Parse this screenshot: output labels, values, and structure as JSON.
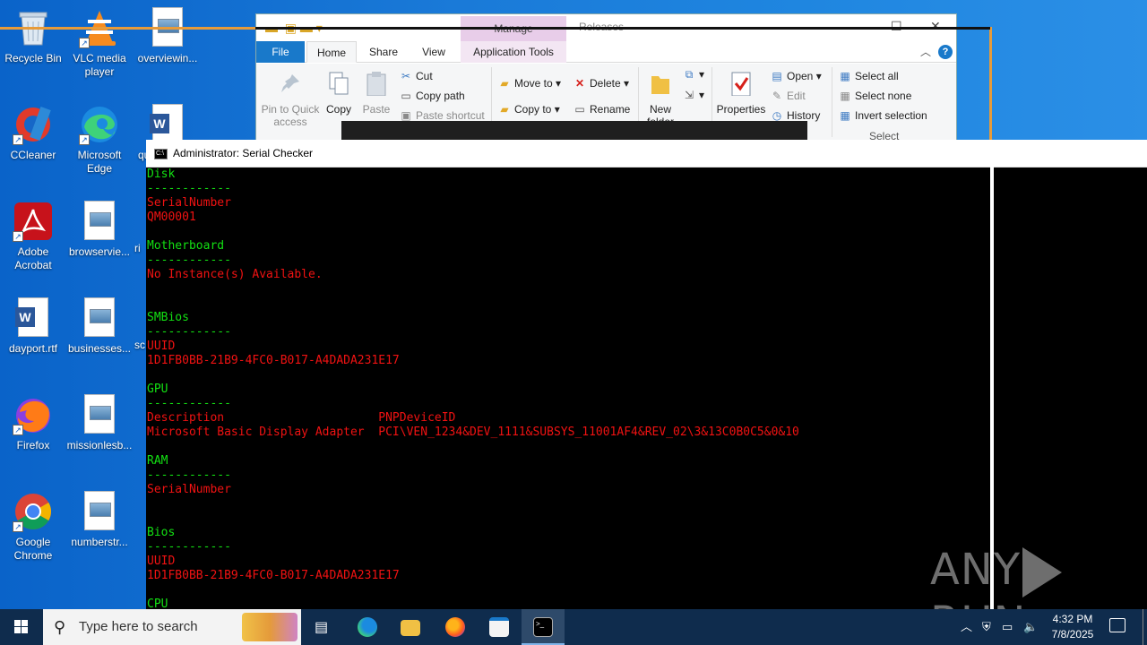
{
  "desktop": {
    "icons": [
      {
        "label": "Recycle Bin",
        "icon": "recycle-bin-icon"
      },
      {
        "label": "VLC media player",
        "icon": "vlc-icon"
      },
      {
        "label": "overviewin...",
        "icon": "image-file-icon"
      },
      {
        "label": "CCleaner",
        "icon": "ccleaner-icon"
      },
      {
        "label": "Microsoft Edge",
        "icon": "edge-icon"
      },
      {
        "label": "qu",
        "icon": "word-file-icon"
      },
      {
        "label": "Adobe Acrobat",
        "icon": "acrobat-icon"
      },
      {
        "label": "browservie...",
        "icon": "image-file-icon"
      },
      {
        "label": "ri",
        "icon": "image-file-icon"
      },
      {
        "label": "dayport.rtf",
        "icon": "word-file-icon"
      },
      {
        "label": "businesses...",
        "icon": "image-file-icon"
      },
      {
        "label": "sc",
        "icon": "image-file-icon"
      },
      {
        "label": "Firefox",
        "icon": "firefox-icon"
      },
      {
        "label": "missionlesb...",
        "icon": "image-file-icon"
      },
      {
        "label": "Google Chrome",
        "icon": "chrome-icon"
      },
      {
        "label": "numberstr...",
        "icon": "image-file-icon"
      }
    ]
  },
  "explorer": {
    "manage_tab": "Manage",
    "title": "Releases",
    "tabs": {
      "file": "File",
      "home": "Home",
      "share": "Share",
      "view": "View",
      "app_tools": "Application Tools"
    },
    "ribbon": {
      "pin": "Pin to Quick access",
      "copy": "Copy",
      "paste": "Paste",
      "cut": "Cut",
      "copy_path": "Copy path",
      "paste_shortcut": "Paste shortcut",
      "move_to": "Move to",
      "copy_to": "Copy to",
      "delete": "Delete",
      "rename": "Rename",
      "new_folder": "New folder",
      "properties": "Properties",
      "open": "Open",
      "edit": "Edit",
      "history": "History",
      "select_all": "Select all",
      "select_none": "Select none",
      "invert_selection": "Invert selection",
      "select_group": "Select"
    }
  },
  "console": {
    "title": "Administrator:  Serial Checker",
    "lines": [
      {
        "text": "Disk",
        "color": "green"
      },
      {
        "text": "------------",
        "color": "green"
      },
      {
        "text": "SerialNumber",
        "color": "red"
      },
      {
        "text": "QM00001",
        "color": "red"
      },
      {
        "text": "",
        "color": "red"
      },
      {
        "text": "Motherboard",
        "color": "green"
      },
      {
        "text": "------------",
        "color": "green"
      },
      {
        "text": "No Instance(s) Available.",
        "color": "red"
      },
      {
        "text": "",
        "color": "red"
      },
      {
        "text": "",
        "color": "red"
      },
      {
        "text": "SMBios",
        "color": "green"
      },
      {
        "text": "------------",
        "color": "green"
      },
      {
        "text": "UUID",
        "color": "red"
      },
      {
        "text": "1D1FB0BB-21B9-4FC0-B017-A4DADA231E17",
        "color": "red"
      },
      {
        "text": "",
        "color": "red"
      },
      {
        "text": "GPU",
        "color": "green"
      },
      {
        "text": "------------",
        "color": "green"
      },
      {
        "text": "Description                      PNPDeviceID",
        "color": "red"
      },
      {
        "text": "Microsoft Basic Display Adapter  PCI\\VEN_1234&DEV_1111&SUBSYS_11001AF4&REV_02\\3&13C0B0C5&0&10",
        "color": "red"
      },
      {
        "text": "",
        "color": "red"
      },
      {
        "text": "RAM",
        "color": "green"
      },
      {
        "text": "------------",
        "color": "green"
      },
      {
        "text": "SerialNumber",
        "color": "red"
      },
      {
        "text": "",
        "color": "red"
      },
      {
        "text": "",
        "color": "red"
      },
      {
        "text": "Bios",
        "color": "green"
      },
      {
        "text": "------------",
        "color": "green"
      },
      {
        "text": "UUID",
        "color": "red"
      },
      {
        "text": "1D1FB0BB-21B9-4FC0-B017-A4DADA231E17",
        "color": "red"
      },
      {
        "text": "",
        "color": "red"
      },
      {
        "text": "CPU",
        "color": "green"
      }
    ]
  },
  "watermark": {
    "left": "ANY",
    "right": "RUN"
  },
  "taskbar": {
    "search_placeholder": "Type here to search",
    "apps": [
      {
        "name": "task-view-icon"
      },
      {
        "name": "edge-icon"
      },
      {
        "name": "file-explorer-icon"
      },
      {
        "name": "firefox-icon"
      },
      {
        "name": "app-window-icon"
      },
      {
        "name": "cmd-icon"
      }
    ],
    "time": "4:32 PM",
    "date": "7/8/2025"
  },
  "colors": {
    "console_green": "#13e013",
    "console_red": "#f01212",
    "accent": "#1979ca"
  }
}
